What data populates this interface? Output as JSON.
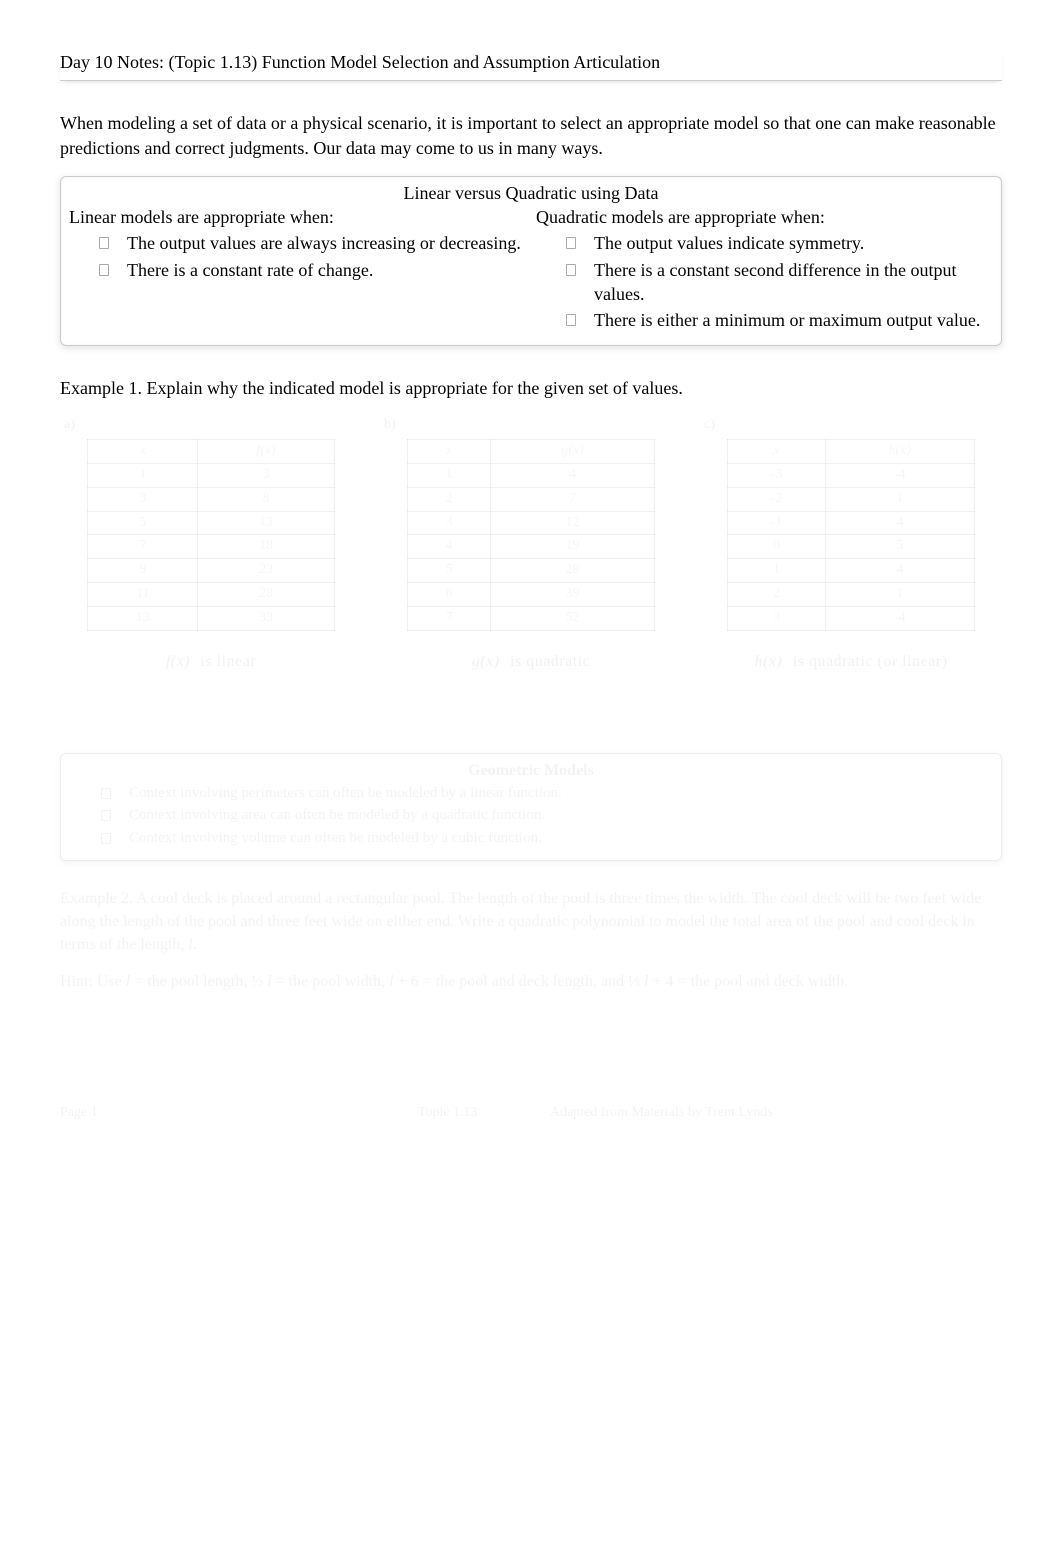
{
  "title": "Day 10 Notes: (Topic 1.13) Function Model Selection and Assumption Articulation",
  "intro": "When modeling a set of data or a physical scenario, it is important to select an appropriate model so that one can make reasonable predictions and correct judgments. Our data may come to us in many ways.",
  "compare": {
    "heading": "Linear versus Quadratic using Data",
    "linear": {
      "head": "Linear models are appropriate when:",
      "items": [
        "The output values are always increasing or decreasing.",
        "There is a constant rate of change."
      ]
    },
    "quadratic": {
      "head": "Quadratic models are appropriate when:",
      "items": [
        "The output values indicate symmetry.",
        "There is a constant second difference in the output values.",
        "There is either a minimum or maximum output value."
      ]
    }
  },
  "example1_prompt": "Example 1. Explain why the indicated model is appropriate for the given set of values.",
  "tables": [
    {
      "label": "a)",
      "x_header": "x",
      "y_header": "f(x)",
      "rows": [
        {
          "x": "1",
          "y": "3"
        },
        {
          "x": "3",
          "y": "8"
        },
        {
          "x": "5",
          "y": "13"
        },
        {
          "x": "7",
          "y": "18"
        },
        {
          "x": "9",
          "y": "23"
        },
        {
          "x": "11",
          "y": "28"
        },
        {
          "x": "13",
          "y": "33"
        }
      ],
      "fn": "f(x)",
      "model": "is linear"
    },
    {
      "label": "b)",
      "x_header": "x",
      "y_header": "g(x)",
      "rows": [
        {
          "x": "1",
          "y": "4"
        },
        {
          "x": "2",
          "y": "7"
        },
        {
          "x": "3",
          "y": "12"
        },
        {
          "x": "4",
          "y": "19"
        },
        {
          "x": "5",
          "y": "28"
        },
        {
          "x": "6",
          "y": "39"
        },
        {
          "x": "7",
          "y": "52"
        }
      ],
      "fn": "g(x)",
      "model": "is quadratic"
    },
    {
      "label": "c)",
      "x_header": "x",
      "y_header": "h(x)",
      "rows": [
        {
          "x": "-3",
          "y": "-4"
        },
        {
          "x": "-2",
          "y": "1"
        },
        {
          "x": "-1",
          "y": "4"
        },
        {
          "x": "0",
          "y": "5"
        },
        {
          "x": "1",
          "y": "4"
        },
        {
          "x": "2",
          "y": "1"
        },
        {
          "x": "3",
          "y": "-4"
        }
      ],
      "fn": "h(x)",
      "model": "is quadratic (or linear)"
    }
  ],
  "geometric": {
    "title": "Geometric Models",
    "items": [
      "Context involving perimeters can often be modeled by a linear function.",
      "Context involving area can often be modeled by a quadratic function.",
      "Context involving volume can often be modeled by a cubic function."
    ]
  },
  "example2": {
    "text_a": "Example 2. A cool deck is placed around a rectangular pool. The length of the pool is three times the width. The cool deck will be two feet wide along the length of the pool and three feet wide on either end. Write a quadratic polynomial to model the total area of the pool and cool deck in terms of the length, ",
    "var_l": "l",
    "text_b": "."
  },
  "hints": {
    "intro": "Hint: Use ",
    "p1a": " = the pool length, ",
    "p1_frac": "⅓",
    "p2a": " = the pool width, ",
    "p3a": " + 6 = the pool and deck length, and ",
    "p3_frac": "⅓",
    "p4a": " + 4 = the pool and deck width.",
    "var_l": "l"
  },
  "footer": {
    "left": "Page 1",
    "mid": "Topic 1.13",
    "right": "Adapted from Materials by Trent Lynds"
  }
}
